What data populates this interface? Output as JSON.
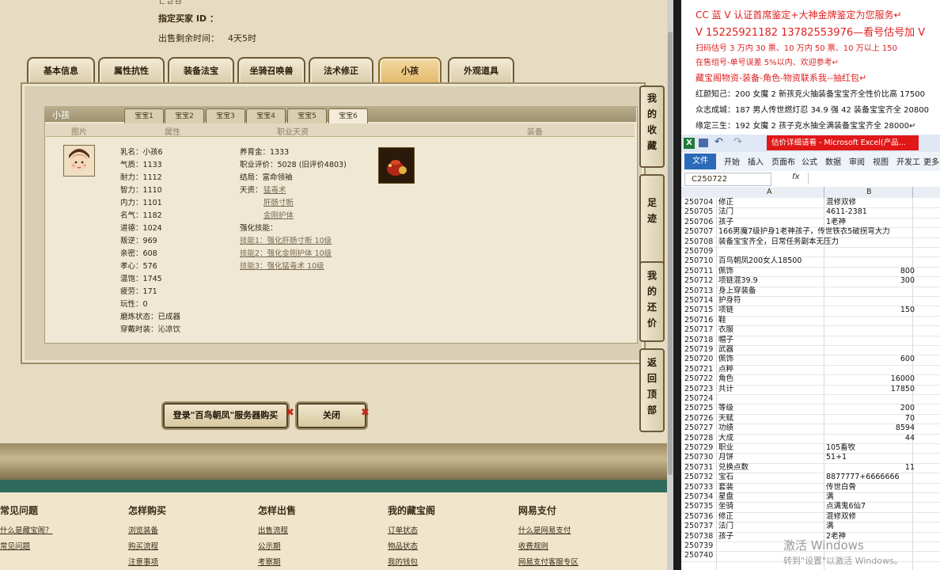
{
  "game": {
    "top_info": {
      "cut_text": "ㄴㄹㅂ",
      "buyer_id_label": "指定买家 ID ：",
      "time_left_label": "出售剩余时间：",
      "time_left_value": "4天5时"
    },
    "tabs": [
      "基本信息",
      "属性抗性",
      "装备法宝",
      "坐骑召唤兽",
      "法术修正",
      "小孩",
      "外观道具"
    ],
    "active_tab": "小孩",
    "panel_title": "小孩",
    "baby_tabs": [
      "宝宝1",
      "宝宝2",
      "宝宝3",
      "宝宝4",
      "宝宝5",
      "宝宝6"
    ],
    "active_baby": "宝宝6",
    "col_headers": {
      "img": "图片",
      "attr": "属性",
      "job": "职业天资",
      "equip": "装备"
    },
    "attrs": [
      {
        "k": "乳名",
        "v": "小孩6"
      },
      {
        "k": "气质",
        "v": "1133"
      },
      {
        "k": "耐力",
        "v": "1112"
      },
      {
        "k": "智力",
        "v": "1110"
      },
      {
        "k": "内力",
        "v": "1101"
      },
      {
        "k": "名气",
        "v": "1182"
      },
      {
        "k": "道德",
        "v": "1024"
      },
      {
        "k": "叛逆",
        "v": "969"
      },
      {
        "k": "亲密",
        "v": "608"
      },
      {
        "k": "孝心",
        "v": "576"
      },
      {
        "k": "温饱",
        "v": "1745"
      },
      {
        "k": "疲劳",
        "v": "171"
      },
      {
        "k": "玩性",
        "v": "0"
      },
      {
        "k": "磨炼状态",
        "v": "已成器"
      },
      {
        "k": "穿戴时装",
        "v": "沁凉饮"
      }
    ],
    "job": {
      "raise_label": "养育金：",
      "raise_value": "1333",
      "eval_label": "职业评价：",
      "eval_value": "5028 (旧评价4803)",
      "ending_label": "结局：",
      "ending_value": "富命领袖",
      "talent_label": "天资：",
      "talents": [
        "猛毒术",
        "肝肠寸断",
        "金刚护体"
      ],
      "skill_label": "强化技能：",
      "skills": [
        "技能1：强化肝肠寸断 10级",
        "技能2：强化金刚护体 10级",
        "技能3：强化猛毒术 10级"
      ]
    },
    "side_buttons": [
      "我的收藏",
      "足迹",
      "我的还价",
      "返回顶部"
    ],
    "login_button": "登录\"百鸟朝凤\"服务器购买",
    "close_button": "关闭",
    "footer": [
      {
        "head": "常见问题",
        "links": [
          "什么是藏宝阁？",
          "常见问题",
          "",
          ""
        ]
      },
      {
        "head": "怎样购买",
        "links": [
          "浏览装备",
          "购买流程",
          "注意事项"
        ]
      },
      {
        "head": "怎样出售",
        "links": [
          "出售流程",
          "公示期",
          "考察期"
        ]
      },
      {
        "head": "我的藏宝阁",
        "links": [
          "订单状态",
          "物品状态",
          "我的钱包"
        ]
      },
      {
        "head": "网易支付",
        "links": [
          "什么是网易支付",
          "收费规则",
          "网易支付客服专区"
        ]
      }
    ]
  },
  "right": {
    "lines": [
      {
        "text": "CC 蓝 V 认证首席鉴定+大神金牌鉴定为您服务↵",
        "color": "red"
      },
      {
        "text": "V 15225921182      13782553976—看号估号加 V",
        "color": "red"
      },
      {
        "text": "扫码估号 3 万内 30 票、10 万内 50 票、10 万以上 150",
        "color": "red"
      },
      {
        "text": "在售组号-单号误差 5%以内、欢迎参考↵",
        "color": "red"
      },
      {
        "text": "藏宝阁物资-装备-角色-物资联系我--抽红包↵",
        "color": "red"
      },
      {
        "text": "红颜知己：200 女魔 2 新孩克火抽装备宝宝齐全性价比高 17500",
        "color": "black"
      },
      {
        "text": "众志成城：187 男人传世燃灯忍 34.9 强 42 装备宝宝齐全 20800",
        "color": "black"
      },
      {
        "text": "缘定三生：192 女魔 2 孩子克水抽全满装备宝宝齐全 28000↵",
        "color": "black"
      }
    ],
    "excel": {
      "title": "估价详细请看 - Microsoft Excel(产品...",
      "ribbon_tabs": [
        "文件",
        "开始",
        "插入",
        "页面布",
        "公式",
        "数据",
        "审阅",
        "视图",
        "开发工",
        "更多"
      ],
      "name_box": "C250722",
      "fx": "fx",
      "col_a": "A",
      "col_b": "B",
      "rows": [
        {
          "n": "250704",
          "a": "修正",
          "b": "混修双修",
          "num": false
        },
        {
          "n": "250705",
          "a": "法门",
          "b": "4611-2381",
          "num": false
        },
        {
          "n": "250706",
          "a": "孩子",
          "b": "1老神",
          "num": false
        },
        {
          "n": "250707",
          "a": "166男魔7级护身1老神孩子，传世铁衣5破拐弯大力",
          "b": "",
          "num": false
        },
        {
          "n": "250708",
          "a": "装备宝宝齐全，日常任务副本无压力",
          "b": "",
          "num": false
        },
        {
          "n": "250709",
          "a": "",
          "b": "",
          "num": false
        },
        {
          "n": "250710",
          "a": "百鸟朝凤200女人18500",
          "b": "",
          "num": false
        },
        {
          "n": "250711",
          "a": "佩饰",
          "b": "800",
          "num": true
        },
        {
          "n": "250712",
          "a": "项链混39.9",
          "b": "300",
          "num": true
        },
        {
          "n": "250713",
          "a": "身上穿装备",
          "b": "",
          "num": false
        },
        {
          "n": "250714",
          "a": "护身符",
          "b": "",
          "num": false
        },
        {
          "n": "250715",
          "a": "项链",
          "b": "150",
          "num": true
        },
        {
          "n": "250716",
          "a": "鞋",
          "b": "",
          "num": false
        },
        {
          "n": "250717",
          "a": "衣服",
          "b": "",
          "num": false
        },
        {
          "n": "250718",
          "a": "帽子",
          "b": "",
          "num": false
        },
        {
          "n": "250719",
          "a": "武器",
          "b": "",
          "num": false
        },
        {
          "n": "250720",
          "a": "佩饰",
          "b": "600",
          "num": true
        },
        {
          "n": "250721",
          "a": "点粹",
          "b": "",
          "num": false
        },
        {
          "n": "250722",
          "a": "角色",
          "b": "16000",
          "num": true
        },
        {
          "n": "250723",
          "a": "共计",
          "b": "17850",
          "num": true
        },
        {
          "n": "250724",
          "a": "",
          "b": "",
          "num": false
        },
        {
          "n": "250725",
          "a": "等级",
          "b": "200",
          "num": true
        },
        {
          "n": "250726",
          "a": "天赋",
          "b": "70",
          "num": true
        },
        {
          "n": "250727",
          "a": "功绩",
          "b": "8594",
          "num": true
        },
        {
          "n": "250728",
          "a": "大成",
          "b": "44",
          "num": true
        },
        {
          "n": "250729",
          "a": "职业",
          "b": "105畜牧",
          "num": false
        },
        {
          "n": "250730",
          "a": "月饼",
          "b": "51+1",
          "num": false
        },
        {
          "n": "250731",
          "a": "兑换点数",
          "b": "11",
          "num": true
        },
        {
          "n": "250732",
          "a": "宝石",
          "b": "8877777+6666666",
          "num": false
        },
        {
          "n": "250733",
          "a": "套装",
          "b": "传世白骨",
          "num": false
        },
        {
          "n": "250734",
          "a": "星盘",
          "b": "满",
          "num": false
        },
        {
          "n": "250735",
          "a": "坐骑",
          "b": "点满鬼6仙7",
          "num": false
        },
        {
          "n": "250736",
          "a": "修正",
          "b": "混修双修",
          "num": false
        },
        {
          "n": "250737",
          "a": "法门",
          "b": "满",
          "num": false
        },
        {
          "n": "250738",
          "a": "孩子",
          "b": "2老神",
          "num": false
        },
        {
          "n": "250739",
          "a": "",
          "b": "",
          "num": false
        },
        {
          "n": "250740",
          "a": "",
          "b": "",
          "num": false
        }
      ]
    },
    "watermark1": "激活 Windows",
    "watermark2": "转到\"设置\"以激活 Windows。"
  }
}
